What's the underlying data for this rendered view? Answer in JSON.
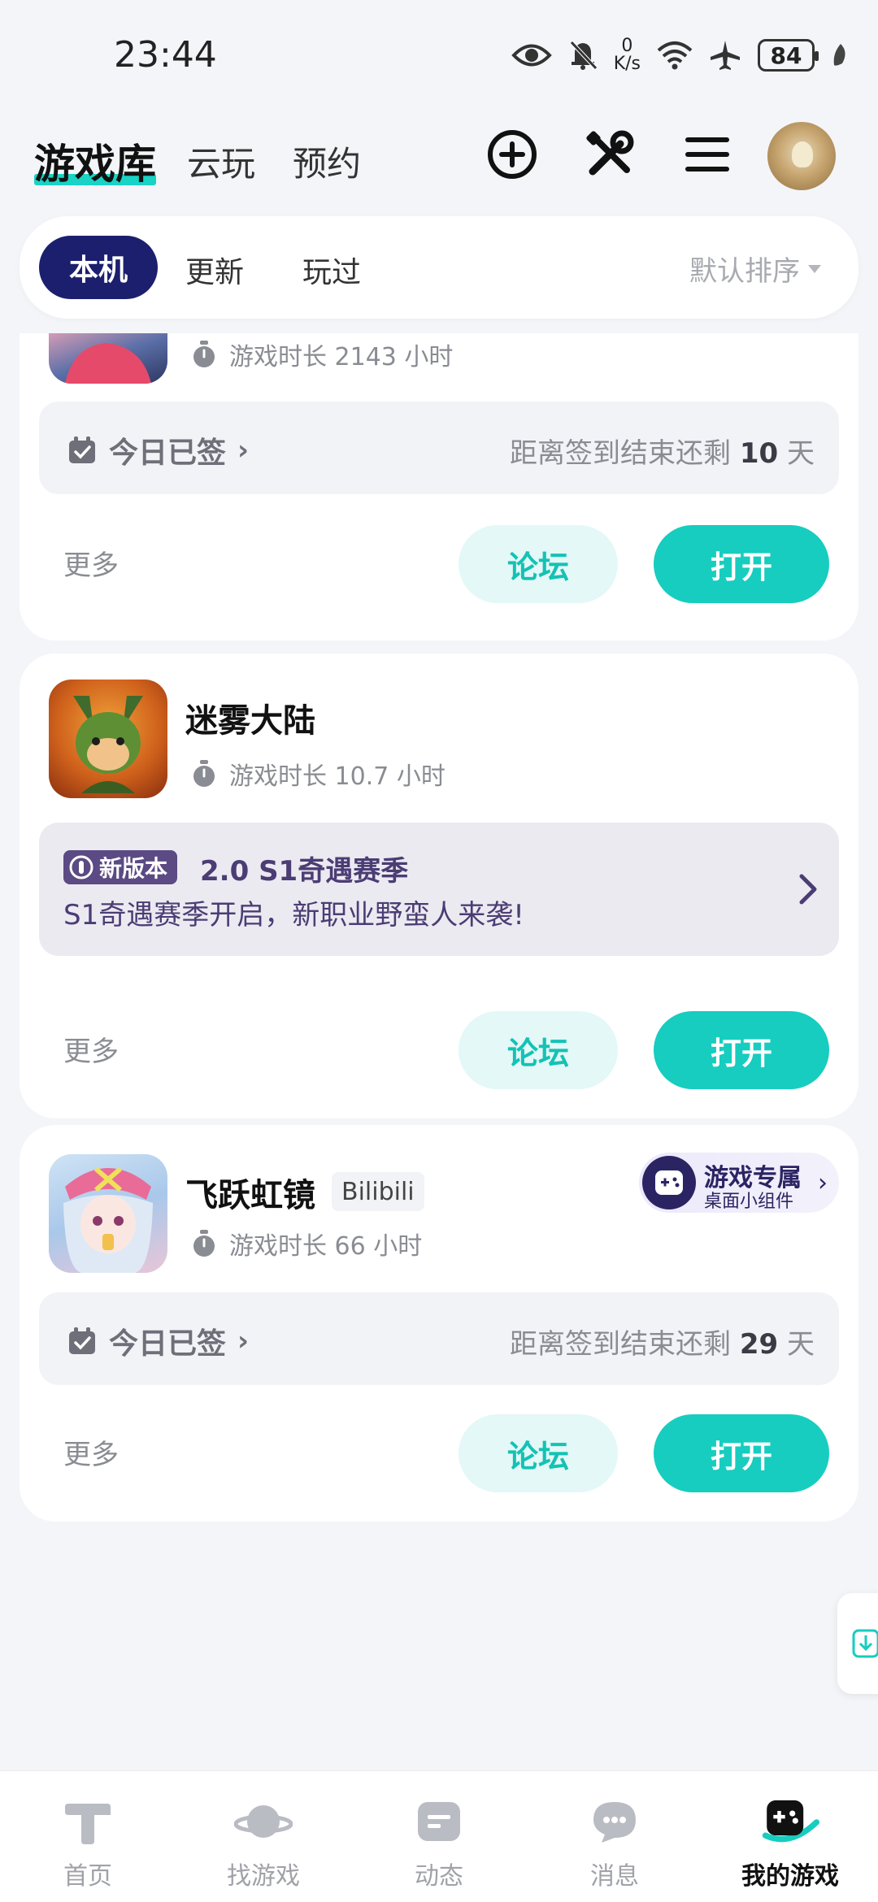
{
  "status_bar": {
    "time": "23:44",
    "net_speed_value": "0",
    "net_speed_unit": "K/s",
    "battery": "84",
    "icons": [
      "eye-icon",
      "bell-mute-icon",
      "wifi-icon",
      "airplane-icon",
      "leaf-icon"
    ]
  },
  "header": {
    "tabs": [
      {
        "label": "游戏库",
        "active": true
      },
      {
        "label": "云玩"
      },
      {
        "label": "预约"
      }
    ],
    "actions": [
      "add-circle-icon",
      "tools-icon",
      "menu-icon"
    ]
  },
  "filter": {
    "chips": [
      "本机",
      "更新",
      "玩过"
    ],
    "active": "本机",
    "sort_label": "默认排序"
  },
  "cards": [
    {
      "title": "",
      "playtime": "游戏时长 2143 小时",
      "sign": {
        "status": "今日已签",
        "remaining_prefix": "距离签到结束还剩",
        "remaining_days": "10",
        "remaining_suffix": "天"
      },
      "more": "更多",
      "forum": "论坛",
      "open": "打开"
    },
    {
      "title": "迷雾大陆",
      "playtime": "游戏时长 10.7 小时",
      "news": {
        "badge": "新版本",
        "title": "2.0 S1奇遇赛季",
        "desc": "S1奇遇赛季开启，新职业野蛮人来袭!"
      },
      "more": "更多",
      "forum": "论坛",
      "open": "打开"
    },
    {
      "title": "飞跃虹镜",
      "tag": "Bilibili",
      "playtime": "游戏时长 66 小时",
      "widget": {
        "line1": "游戏专属",
        "line2": "桌面小组件"
      },
      "sign": {
        "status": "今日已签",
        "remaining_prefix": "距离签到结束还剩",
        "remaining_days": "29",
        "remaining_suffix": "天"
      },
      "more": "更多",
      "forum": "论坛",
      "open": "打开"
    }
  ],
  "bottom_nav": [
    {
      "label": "首页",
      "icon": "home-t-icon"
    },
    {
      "label": "找游戏",
      "icon": "planet-icon"
    },
    {
      "label": "动态",
      "icon": "feed-icon"
    },
    {
      "label": "消息",
      "icon": "chat-bubble-icon"
    },
    {
      "label": "我的游戏",
      "icon": "gamepad-icon",
      "active": true
    }
  ],
  "colors": {
    "accent": "#17cdbf",
    "navy": "#1c1f6e",
    "purple": "#4b3d74"
  }
}
